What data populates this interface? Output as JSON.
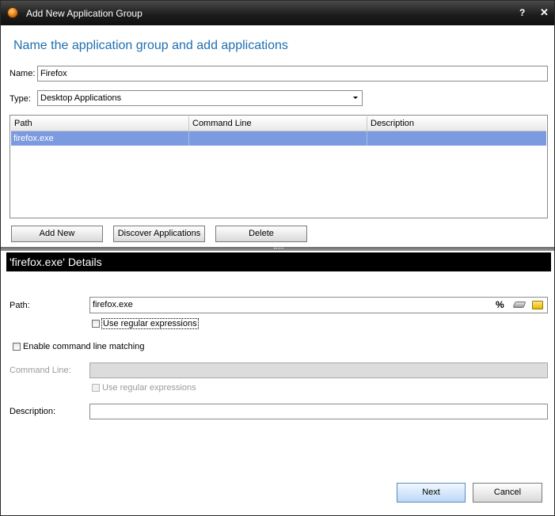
{
  "window": {
    "title": "Add New Application Group",
    "help_glyph": "?",
    "close_glyph": "✕"
  },
  "heading": "Name the application group and add applications",
  "form": {
    "name_label": "Name:",
    "name_value": "Firefox",
    "type_label": "Type:",
    "type_value": "Desktop Applications"
  },
  "grid": {
    "columns": [
      "Path",
      "Command Line",
      "Description"
    ],
    "rows": [
      {
        "path": "firefox.exe",
        "command_line": "",
        "description": ""
      }
    ]
  },
  "grid_buttons": {
    "add_new": "Add New",
    "discover": "Discover Applications",
    "delete": "Delete"
  },
  "details": {
    "title": "'firefox.exe' Details",
    "path_label": "Path:",
    "path_value": "firefox.exe",
    "percent_glyph": "%",
    "use_regex_label": "Use regular expressions",
    "enable_cmd_label": "Enable command line matching",
    "command_line_label": "Command Line:",
    "command_line_value": "",
    "cmd_regex_label": "Use regular expressions",
    "description_label": "Description:",
    "description_value": ""
  },
  "footer": {
    "next": "Next",
    "cancel": "Cancel"
  }
}
